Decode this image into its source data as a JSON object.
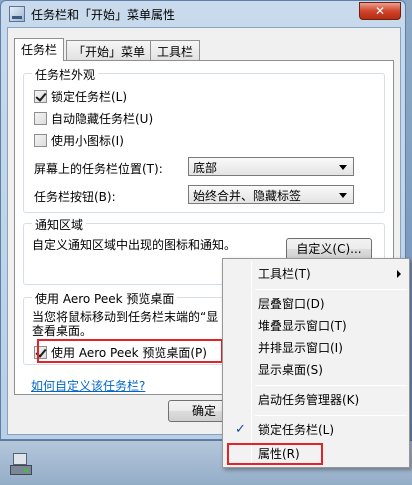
{
  "window": {
    "title": "任务栏和「开始」菜单属性",
    "close_glyph": "✕"
  },
  "tabs": [
    {
      "label": "任务栏",
      "active": true
    },
    {
      "label": "「开始」菜单",
      "active": false
    },
    {
      "label": "工具栏",
      "active": false
    }
  ],
  "appearance": {
    "legend": "任务栏外观",
    "lock_taskbar": {
      "label": "锁定任务栏(L)",
      "checked": true
    },
    "auto_hide": {
      "label": "自动隐藏任务栏(U)",
      "checked": false
    },
    "small_icons": {
      "label": "使用小图标(I)",
      "checked": false
    },
    "position": {
      "label": "屏幕上的任务栏位置(T):",
      "value": "底部"
    },
    "buttons": {
      "label": "任务栏按钮(B):",
      "value": "始终合并、隐藏标签"
    }
  },
  "notification": {
    "legend": "通知区域",
    "desc": "自定义通知区域中出现的图标和通知。",
    "customize_button": "自定义(C)..."
  },
  "aero_peek": {
    "legend": "使用 Aero Peek 预览桌面",
    "desc_line1": "当您将鼠标移动到任务栏末端的“显",
    "desc_line2": "查看桌面。",
    "checkbox": {
      "label": "使用 Aero Peek 预览桌面(P)",
      "checked": true
    }
  },
  "link": "如何自定义该任务栏?",
  "footer": {
    "ok_button": "确定"
  },
  "context_menu": {
    "items": [
      {
        "label": "工具栏(T)",
        "submenu": true
      },
      {
        "label": "层叠窗口(D)"
      },
      {
        "label": "堆叠显示窗口(T)"
      },
      {
        "label": "并排显示窗口(I)"
      },
      {
        "label": "显示桌面(S)"
      },
      {
        "label": "启动任务管理器(K)"
      },
      {
        "label": "锁定任务栏(L)",
        "checked": true
      },
      {
        "label": "属性(R)",
        "highlighted": true
      }
    ]
  },
  "colors": {
    "highlight_border": "#e2242a",
    "link": "#0066cc"
  }
}
